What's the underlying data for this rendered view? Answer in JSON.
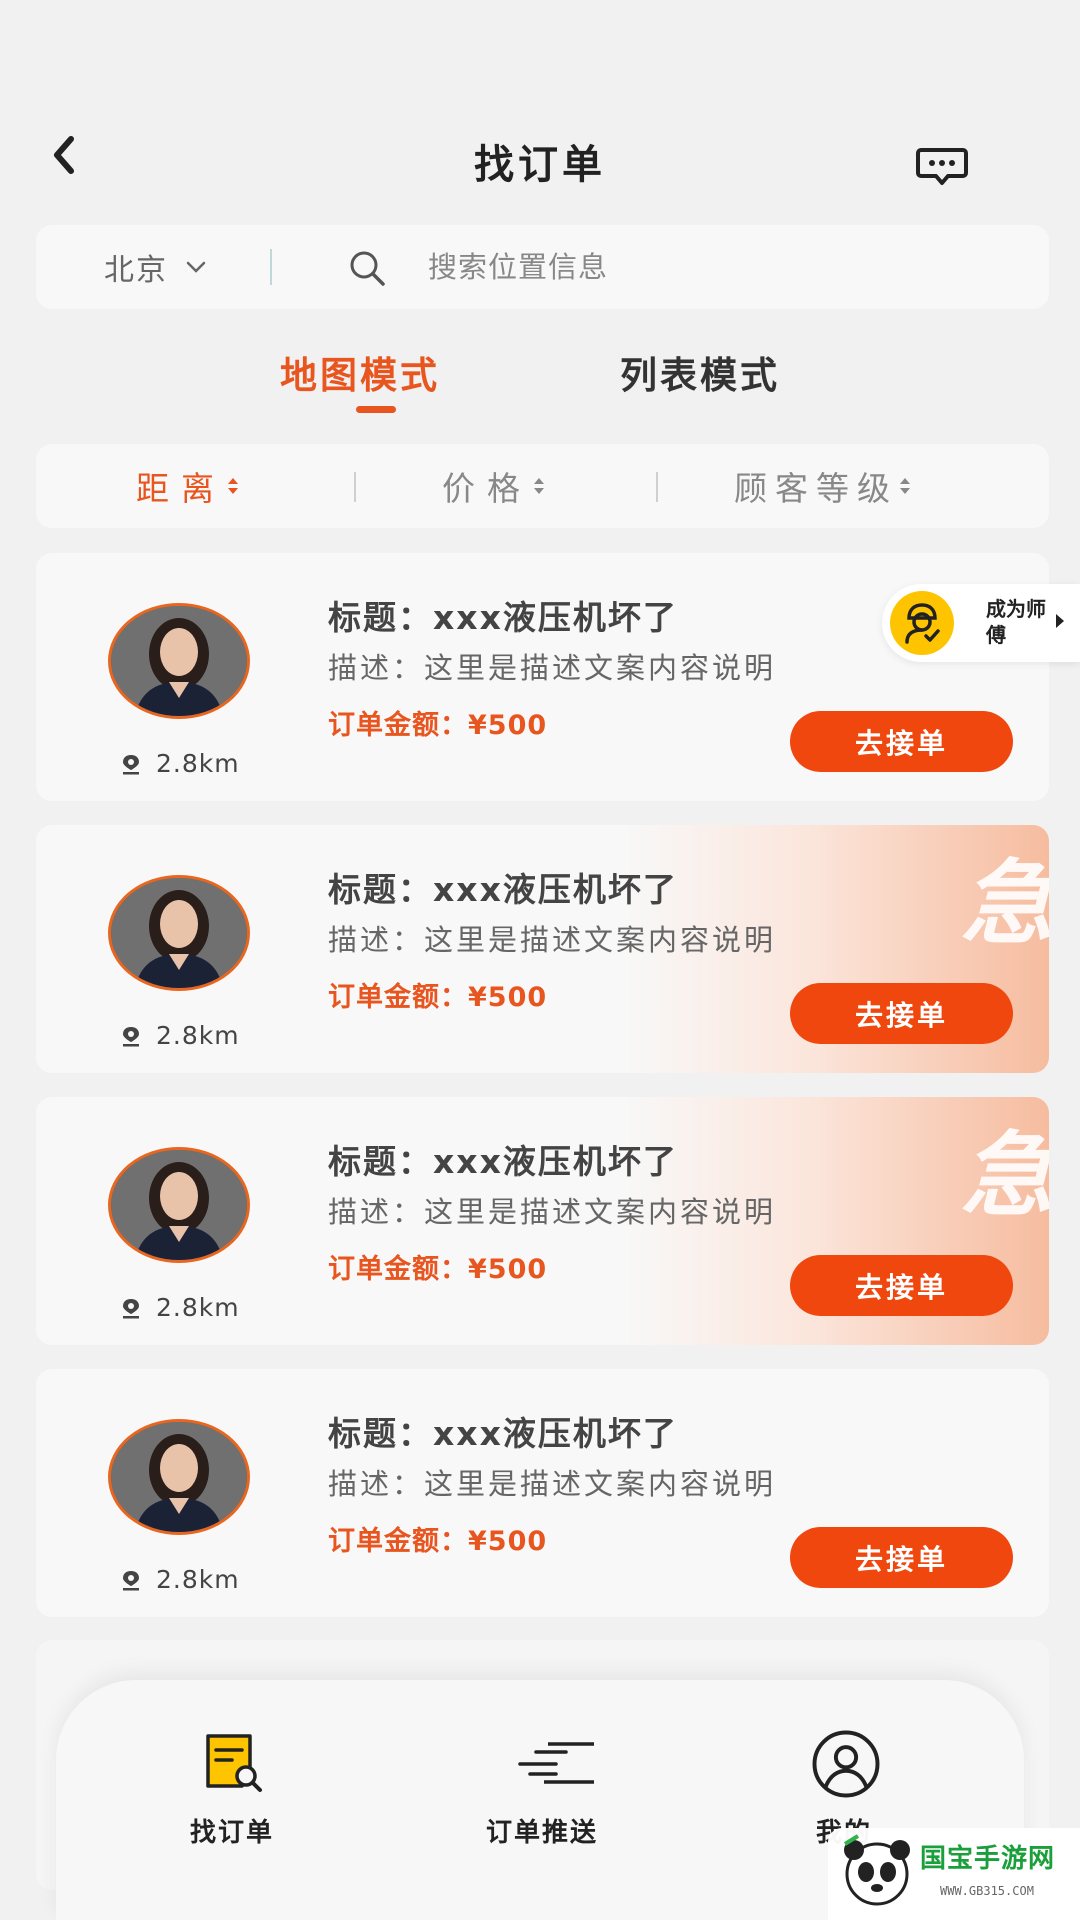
{
  "header": {
    "title": "找订单"
  },
  "search": {
    "city": "北京",
    "placeholder": "搜索位置信息"
  },
  "mode_tabs": [
    {
      "label": "地图模式",
      "active": true
    },
    {
      "label": "列表模式",
      "active": false
    }
  ],
  "sort": [
    {
      "label": "距离",
      "active": true
    },
    {
      "label": "价格",
      "active": false
    },
    {
      "label": "顾客等级",
      "active": false
    }
  ],
  "orders": [
    {
      "title": "标题：xxx液压机坏了",
      "description": "描述：这里是描述文案内容说明",
      "price": "订单金额：¥500",
      "distance": "2.8km",
      "action": "去接单",
      "urgent": false
    },
    {
      "title": "标题：xxx液压机坏了",
      "description": "描述：这里是描述文案内容说明",
      "price": "订单金额：¥500",
      "distance": "2.8km",
      "action": "去接单",
      "urgent": true,
      "urgent_label": "急"
    },
    {
      "title": "标题：xxx液压机坏了",
      "description": "描述：这里是描述文案内容说明",
      "price": "订单金额：¥500",
      "distance": "2.8km",
      "action": "去接单",
      "urgent": true,
      "urgent_label": "急"
    },
    {
      "title": "标题：xxx液压机坏了",
      "description": "描述：这里是描述文案内容说明",
      "price": "订单金额：¥500",
      "distance": "2.8km",
      "action": "去接单",
      "urgent": false
    }
  ],
  "become_master": {
    "label": "成为师傅"
  },
  "bottom_nav": [
    {
      "label": "找订单",
      "icon": "find-order-icon"
    },
    {
      "label": "订单推送",
      "icon": "order-push-icon"
    },
    {
      "label": "我的",
      "icon": "user-icon"
    }
  ],
  "watermark": {
    "text": "国宝手游网",
    "url": "WWW.GB315.COM"
  },
  "colors": {
    "accent": "#e8551f",
    "button": "#f0470e",
    "badge": "#ffc400"
  }
}
